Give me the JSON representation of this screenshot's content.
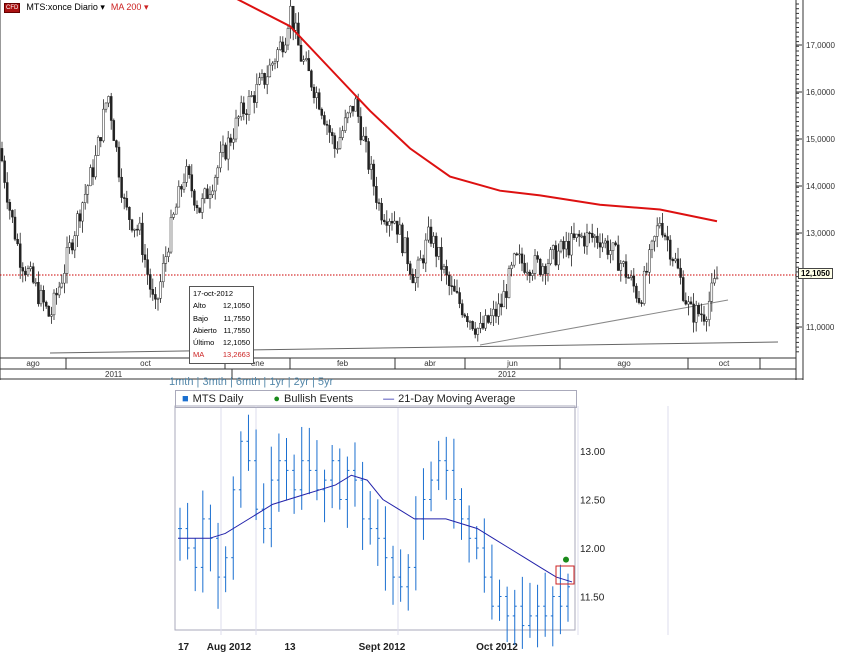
{
  "top": {
    "symbol": "MTS:xonce Diario",
    "ma_label": "MA 200",
    "logo": "CFD",
    "current_price": "12,1050",
    "tooltip": {
      "date": "17-oct-2012",
      "rows": [
        [
          "Alto",
          "12,1050"
        ],
        [
          "Bajo",
          "11,7550"
        ],
        [
          "Abierto",
          "11,7550"
        ],
        [
          "Último",
          "12,1050"
        ],
        [
          "MA",
          "13,2663"
        ]
      ]
    },
    "colors": {
      "ma": "#dd1111",
      "price": "#222222",
      "ref": "#cc0000"
    }
  },
  "bottom": {
    "ranges": [
      "1mth",
      "3mth",
      "6mth",
      "1yr",
      "2yr",
      "5yr"
    ],
    "legend": [
      "MTS Daily",
      "Bullish Events",
      "21-Day Moving Average"
    ],
    "colors": {
      "bars": "#1a6fd0",
      "ma": "#2222aa",
      "bullish": "#1a8a1a",
      "box": "#cc2222"
    }
  },
  "chart_data": [
    {
      "type": "bar",
      "title": "MTS:xonce Diario",
      "ylim": [
        10.5,
        18.0
      ],
      "yticks": [
        "17,0000",
        "16,0000",
        "15,0000",
        "14,0000",
        "13,0000",
        "11,0000"
      ],
      "ytick_values": [
        17,
        16,
        15,
        14,
        13,
        11
      ],
      "months": [
        "ago",
        "oct",
        "ene",
        "feb",
        "abr",
        "jun",
        "ago",
        "oct"
      ],
      "years": [
        "2011",
        "2012"
      ],
      "close": [
        [
          0,
          14.8
        ],
        [
          10,
          13.5
        ],
        [
          20,
          12.5
        ],
        [
          50,
          11.2
        ],
        [
          65,
          12.3
        ],
        [
          80,
          13.5
        ],
        [
          95,
          14.5
        ],
        [
          108,
          16.0
        ],
        [
          125,
          13.5
        ],
        [
          140,
          13.0
        ],
        [
          155,
          11.3
        ],
        [
          170,
          13.0
        ],
        [
          185,
          14.3
        ],
        [
          200,
          13.5
        ],
        [
          220,
          14.5
        ],
        [
          240,
          15.5
        ],
        [
          265,
          16.3
        ],
        [
          285,
          17.2
        ],
        [
          290,
          17.8
        ],
        [
          300,
          16.8
        ],
        [
          320,
          15.8
        ],
        [
          335,
          14.8
        ],
        [
          355,
          15.8
        ],
        [
          365,
          14.8
        ],
        [
          380,
          13.5
        ],
        [
          395,
          13.3
        ],
        [
          415,
          12.0
        ],
        [
          430,
          13.0
        ],
        [
          450,
          11.8
        ],
        [
          480,
          10.9
        ],
        [
          500,
          11.4
        ],
        [
          515,
          12.4
        ],
        [
          540,
          12.3
        ],
        [
          560,
          12.6
        ],
        [
          580,
          12.9
        ],
        [
          600,
          12.9
        ],
        [
          620,
          12.4
        ],
        [
          640,
          11.6
        ],
        [
          660,
          13.3
        ],
        [
          675,
          12.4
        ],
        [
          690,
          11.3
        ],
        [
          705,
          11.3
        ],
        [
          718,
          12.1
        ]
      ],
      "ma200": [
        [
          235,
          18.0
        ],
        [
          290,
          17.4
        ],
        [
          330,
          16.5
        ],
        [
          370,
          15.6
        ],
        [
          410,
          14.8
        ],
        [
          450,
          14.2
        ],
        [
          500,
          13.9
        ],
        [
          540,
          13.8
        ],
        [
          600,
          13.6
        ],
        [
          660,
          13.5
        ],
        [
          717,
          13.25
        ]
      ]
    },
    {
      "type": "bar",
      "ylim": [
        11.1,
        13.45
      ],
      "yticks": [
        "13.00",
        "12.50",
        "12.00",
        "11.50"
      ],
      "ytick_values": [
        13.0,
        12.5,
        12.0,
        11.5
      ],
      "xticks": [
        "17",
        "Aug 2012",
        "13",
        "Sept 2012",
        "Oct 2012"
      ],
      "close": [
        12.2,
        12.0,
        11.8,
        12.3,
        12.1,
        11.7,
        11.9,
        12.6,
        13.1,
        12.9,
        12.4,
        12.2,
        12.7,
        12.9,
        12.8,
        12.6,
        12.9,
        12.8,
        12.6,
        12.7,
        12.9,
        12.5,
        12.8,
        12.7,
        12.3,
        12.2,
        12.1,
        11.9,
        11.7,
        11.6,
        11.8,
        12.3,
        12.5,
        12.7,
        12.9,
        12.8,
        12.5,
        12.3,
        12.1,
        12.0,
        11.7,
        11.4,
        11.5,
        11.3,
        11.4,
        11.2,
        11.3,
        11.4,
        11.3,
        11.5,
        11.4,
        11.6
      ],
      "ma21": [
        12.1,
        12.1,
        12.1,
        12.15,
        12.25,
        12.35,
        12.45,
        12.5,
        12.55,
        12.6,
        12.65,
        12.75,
        12.7,
        12.5,
        12.4,
        12.3,
        12.3,
        12.3,
        12.25,
        12.2,
        12.1,
        12.0,
        11.9,
        11.8,
        11.7,
        11.65
      ],
      "bullish_event": 11.88
    }
  ]
}
